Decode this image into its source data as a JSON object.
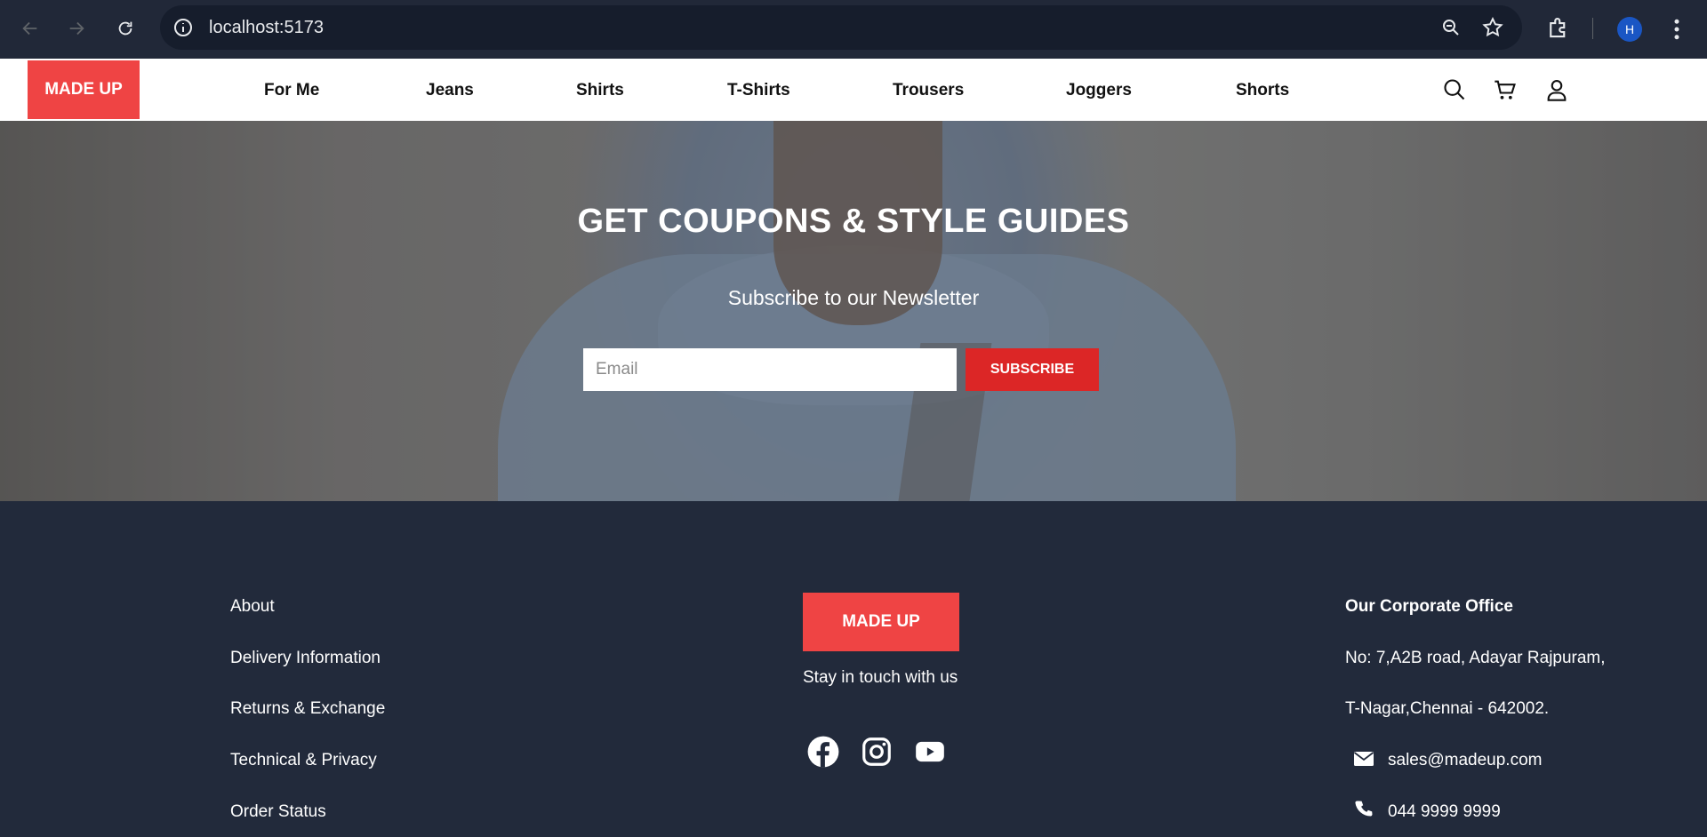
{
  "browser": {
    "url": "localhost:5173",
    "profile_initial": "H",
    "icons": [
      "back-arrow-icon",
      "forward-arrow-icon",
      "reload-icon",
      "site-info-icon",
      "zoom-icon",
      "bookmark-star-icon",
      "extensions-icon",
      "menu-kebab-icon"
    ]
  },
  "header": {
    "logo": "MADE UP",
    "nav": [
      "For Me",
      "Jeans",
      "Shirts",
      "T-Shirts",
      "Trousers",
      "Joggers",
      "Shorts"
    ],
    "icons": [
      "search-icon",
      "cart-icon",
      "user-icon"
    ]
  },
  "hero": {
    "title": "GET COUPONS & STYLE GUIDES",
    "subtitle": "Subscribe to our Newsletter",
    "email_placeholder": "Email",
    "subscribe_label": "SUBSCRIBE"
  },
  "footer": {
    "links": [
      "About",
      "Delivery Information",
      "Returns & Exchange",
      "Technical & Privacy",
      "Order Status"
    ],
    "logo": "MADE UP",
    "tagline": "Stay in touch with us",
    "social_icons": [
      "facebook-icon",
      "instagram-icon",
      "youtube-icon"
    ],
    "office_title": "Our Corporate Office",
    "address_line1": "No: 7,A2B road, Adayar Rajpuram,",
    "address_line2": "T-Nagar,Chennai - 642002.",
    "email": "sales@madeup.com",
    "phone": "044 9999 9999"
  },
  "colors": {
    "brand_red": "#ef4444",
    "subscribe_red": "#dc2626",
    "footer_bg": "#222a3b"
  }
}
